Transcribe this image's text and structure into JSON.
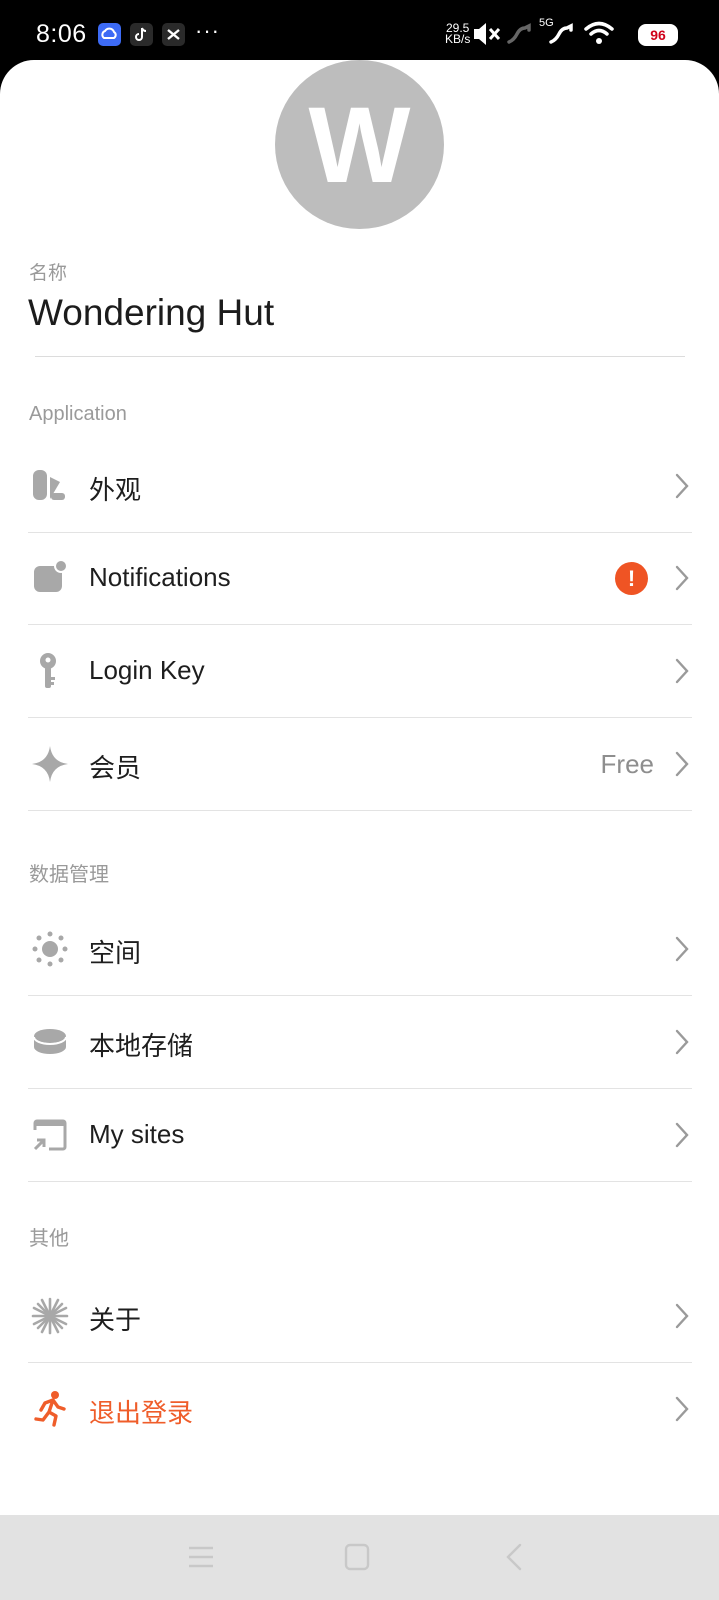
{
  "status_bar": {
    "time": "8:06",
    "net_speed_value": "29.5",
    "net_speed_unit": "KB/s",
    "network_type": "5G",
    "battery": "96",
    "apps": [
      "cloud-app-icon",
      "tiktok-icon",
      "capcut-icon"
    ]
  },
  "profile": {
    "avatar_letter": "W",
    "name_label": "名称",
    "name_value": "Wondering Hut"
  },
  "sections": {
    "application": {
      "title": "Application",
      "items": [
        {
          "label": "外观",
          "icon": "appearance-icon"
        },
        {
          "label": "Notifications",
          "icon": "notification-icon",
          "badge": "!"
        },
        {
          "label": "Login Key",
          "icon": "key-icon"
        },
        {
          "label": "会员",
          "icon": "sparkle-icon",
          "value": "Free"
        }
      ]
    },
    "data": {
      "title": "数据管理",
      "items": [
        {
          "label": "空间",
          "icon": "space-icon"
        },
        {
          "label": "本地存储",
          "icon": "storage-icon"
        },
        {
          "label": "My sites",
          "icon": "cast-icon"
        }
      ]
    },
    "other": {
      "title": "其他",
      "items": [
        {
          "label": "关于",
          "icon": "about-icon"
        },
        {
          "label": "退出登录",
          "icon": "exit-icon",
          "color": "#ef5d2a"
        }
      ]
    }
  },
  "colors": {
    "accent_danger": "#ef5d2a",
    "badge": "#ef5424",
    "icon_gray": "#a8a8a8"
  }
}
